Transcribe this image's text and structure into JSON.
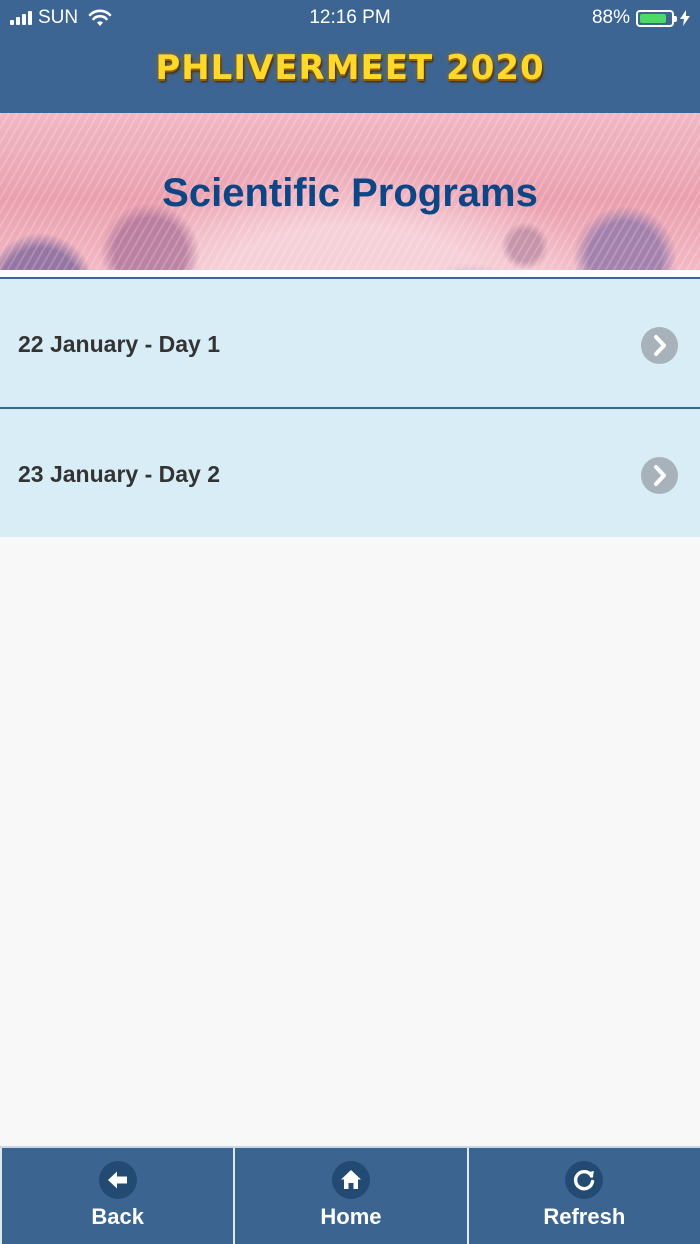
{
  "status_bar": {
    "carrier": "SUN",
    "time": "12:16 PM",
    "battery_percent": "88%",
    "battery_level": 0.88,
    "icons": [
      "signal-icon",
      "wifi-icon",
      "battery-icon",
      "charging-bolt-icon"
    ]
  },
  "header": {
    "app_title": "PHLIVERMEET 2020"
  },
  "banner": {
    "title": "Scientific Programs"
  },
  "program_days": [
    {
      "label": "22 January - Day 1",
      "icon": "chevron-right-icon"
    },
    {
      "label": "23 January - Day 2",
      "icon": "chevron-right-icon"
    }
  ],
  "tab_bar": {
    "back": {
      "label": "Back",
      "icon": "arrow-left-icon"
    },
    "home": {
      "label": "Home",
      "icon": "home-icon"
    },
    "refresh": {
      "label": "Refresh",
      "icon": "refresh-icon"
    }
  },
  "colors": {
    "header_bg": "#3c6593",
    "title_gold": "#ffd92a",
    "banner_title": "#0e4585",
    "row_bg": "#d9edf7",
    "tab_bg": "#3b6590",
    "battery_green": "#4cd964"
  }
}
